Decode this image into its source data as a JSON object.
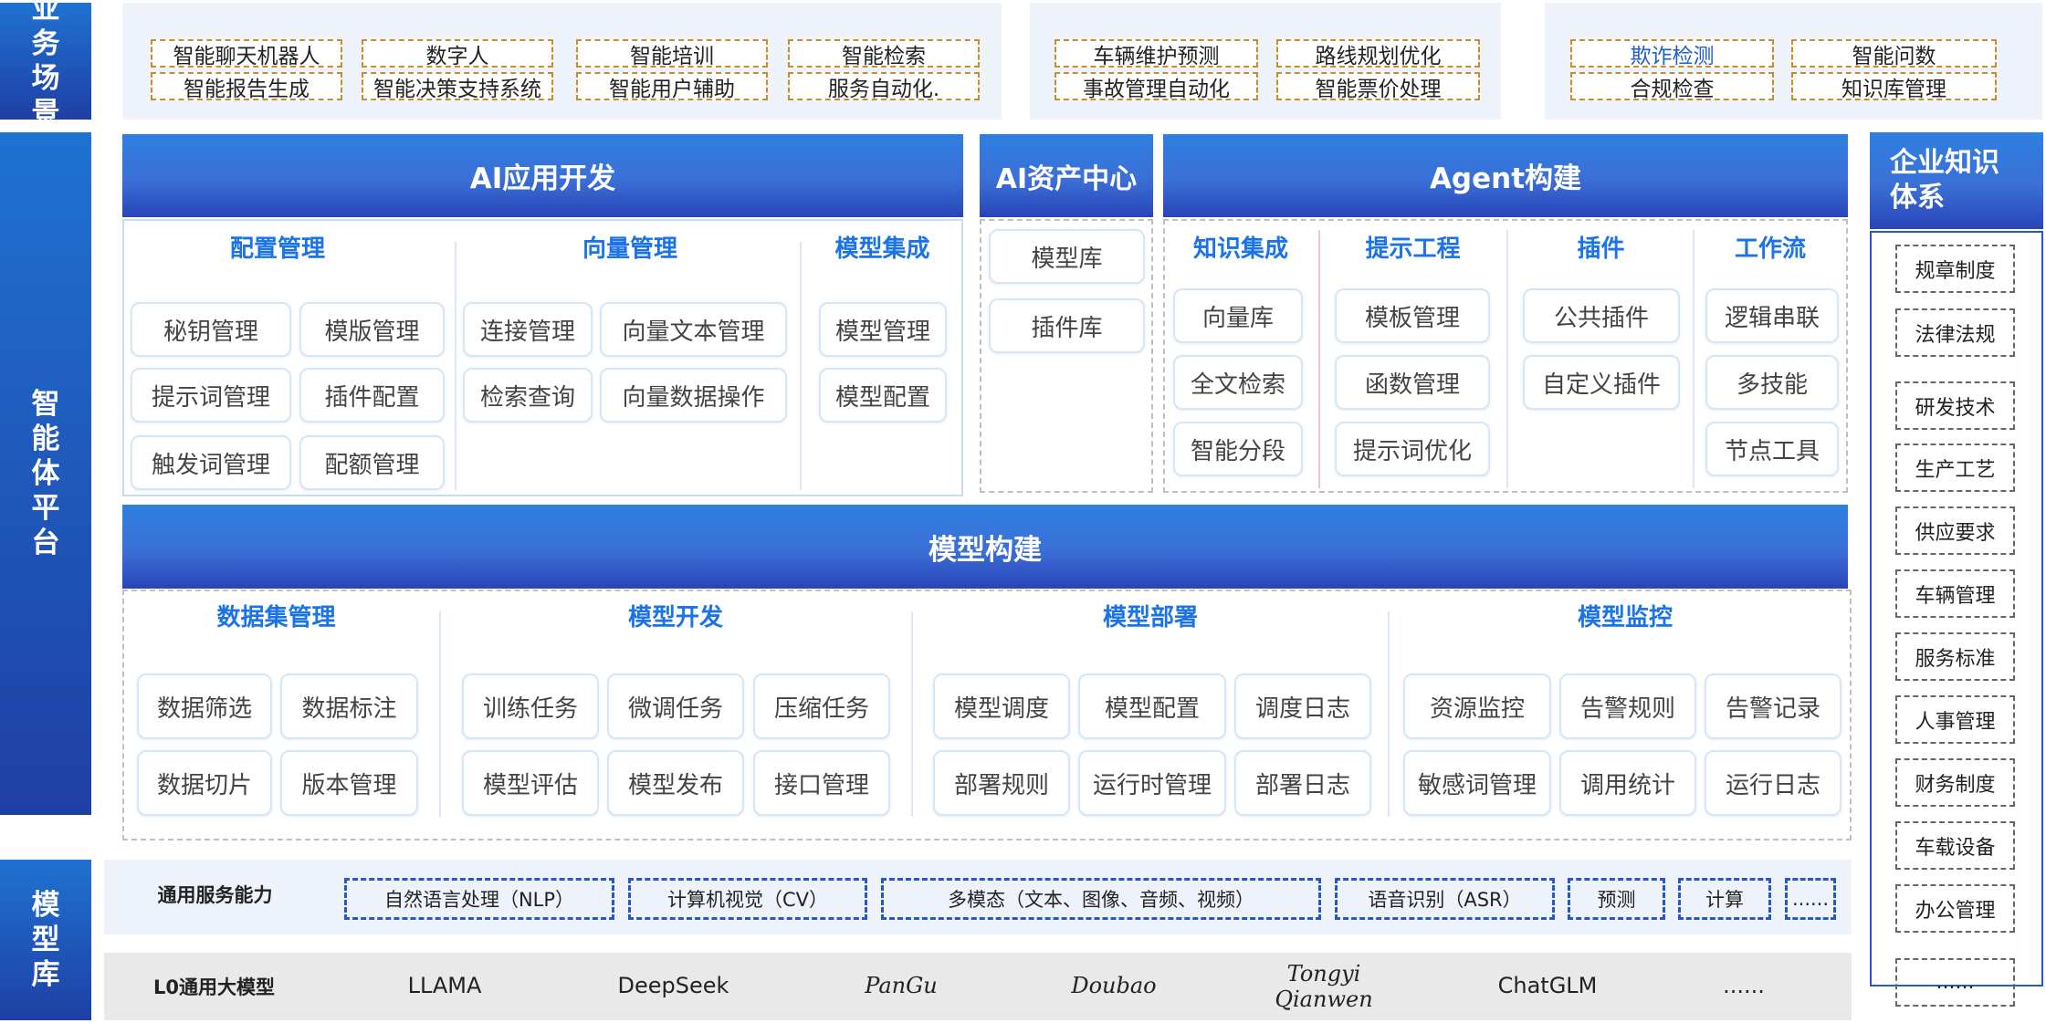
{
  "layers": {
    "business": "业务场景",
    "platform": "智能体平台",
    "model_lib": "模型库"
  },
  "scenes": {
    "group1": [
      "智能聊天机器人",
      "数字人",
      "智能培训",
      "智能检索",
      "智能报告生成",
      "智能决策支持系统",
      "智能用户辅助",
      "服务自动化."
    ],
    "group2": [
      "车辆维护预测",
      "路线规划优化",
      "事故管理自动化",
      "智能票价处理"
    ],
    "group3": [
      "欺诈检测",
      "智能问数",
      "合规检查",
      "知识库管理"
    ]
  },
  "ai_app": {
    "title": "AI应用开发",
    "config": {
      "title": "配置管理",
      "items": [
        "秘钥管理",
        "模版管理",
        "提示词管理",
        "插件配置",
        "触发词管理",
        "配额管理"
      ]
    },
    "vector": {
      "title": "向量管理",
      "items": [
        "连接管理",
        "向量文本管理",
        "检索查询",
        "向量数据操作"
      ]
    },
    "model_int": {
      "title": "模型集成",
      "items": [
        "模型管理",
        "模型配置"
      ]
    }
  },
  "asset": {
    "title": "AI资产中心",
    "items": [
      "模型库",
      "插件库"
    ]
  },
  "agent": {
    "title": "Agent构建",
    "knowledge": {
      "title": "知识集成",
      "items": [
        "向量库",
        "全文检索",
        "智能分段"
      ]
    },
    "prompt": {
      "title": "提示工程",
      "items": [
        "模板管理",
        "函数管理",
        "提示词优化"
      ]
    },
    "plugin": {
      "title": "插件",
      "items": [
        "公共插件",
        "自定义插件"
      ]
    },
    "workflow": {
      "title": "工作流",
      "items": [
        "逻辑串联",
        "多技能",
        "节点工具"
      ]
    }
  },
  "model_build": {
    "title": "模型构建",
    "dataset": {
      "title": "数据集管理",
      "items": [
        "数据筛选",
        "数据标注",
        "数据切片",
        "版本管理"
      ]
    },
    "dev": {
      "title": "模型开发",
      "items": [
        "训练任务",
        "微调任务",
        "压缩任务",
        "模型评估",
        "模型发布",
        "接口管理"
      ]
    },
    "deploy": {
      "title": "模型部署",
      "items": [
        "模型调度",
        "模型配置",
        "调度日志",
        "部署规则",
        "运行时管理",
        "部署日志"
      ]
    },
    "monitor": {
      "title": "模型监控",
      "items": [
        "资源监控",
        "告警规则",
        "告警记录",
        "敏感词管理",
        "调用统计",
        "运行日志"
      ]
    }
  },
  "enterprise": {
    "title": "企业知识体系",
    "items": [
      "规章制度",
      "法律法规",
      "研发技术",
      "生产工艺",
      "供应要求",
      "车辆管理",
      "服务标准",
      "人事管理",
      "财务制度",
      "车载设备",
      "办公管理",
      "......"
    ]
  },
  "general": {
    "label": "通用服务能力",
    "items": [
      "自然语言处理（NLP）",
      "计算机视觉（CV）",
      "多模态（文本、图像、音频、视频）",
      "语音识别（ASR）",
      "预测",
      "计算",
      "......"
    ]
  },
  "l0": {
    "label": "L0通用大模型",
    "models": [
      "LLAMA",
      "DeepSeek",
      "PanGu",
      "Doubao",
      "Tongyi Qianwen",
      "ChatGLM",
      "......"
    ]
  }
}
